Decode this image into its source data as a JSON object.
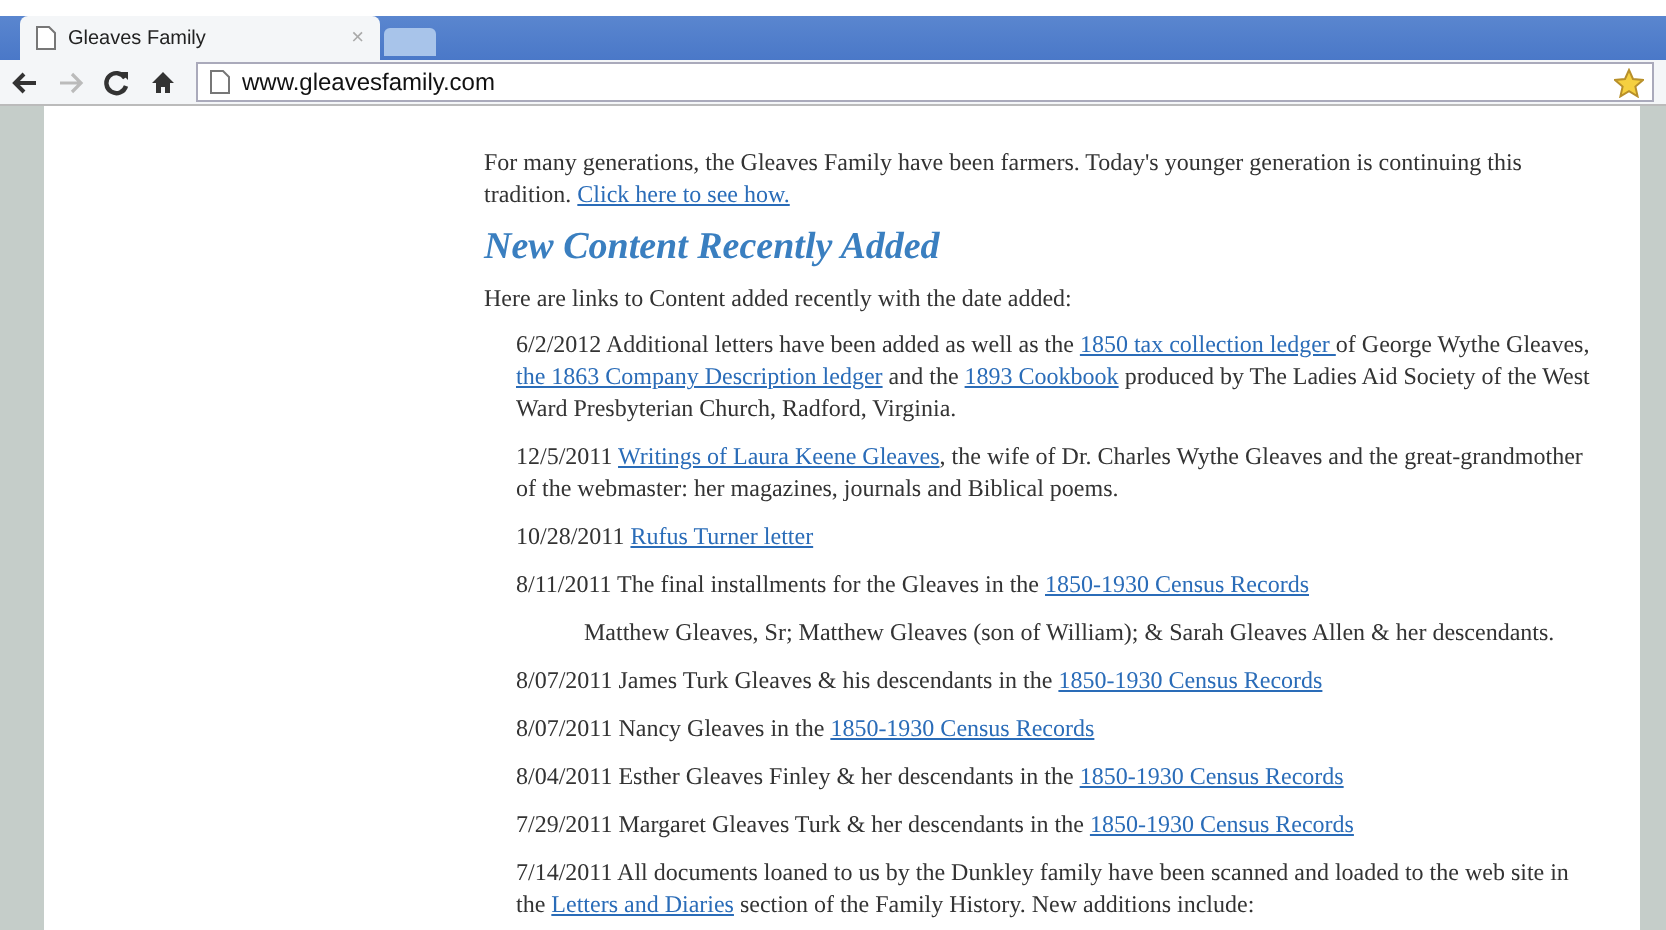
{
  "browser": {
    "tab_title": "Gleaves Family",
    "tab_close": "×",
    "address": "www.gleavesfamily.com"
  },
  "intro": [
    {
      "text": "For many generations, the Gleaves Family have been farmers.  Today's younger generation is continuing this tradition.  ",
      "link": false
    },
    {
      "text": "Click here to see how.",
      "link": true
    }
  ],
  "heading": "New Content Recently Added",
  "lead": "Here are links to Content added recently with the date added:",
  "entries": [
    {
      "kind": "entry",
      "parts": [
        {
          "text": "6/2/2012 Additional letters have been added as well as the ",
          "link": false
        },
        {
          "text": "1850 tax collection ledger ",
          "link": true
        },
        {
          "text": "of George Wythe Gleaves, ",
          "link": false
        },
        {
          "text": "the 1863 Company Description ledger",
          "link": true
        },
        {
          "text": " and the ",
          "link": false
        },
        {
          "text": "1893 Cookbook",
          "link": true
        },
        {
          "text": " produced by The Ladies Aid Society of the West Ward Presbyterian Church, Radford, Virginia.",
          "link": false
        }
      ]
    },
    {
      "kind": "entry",
      "parts": [
        {
          "text": "12/5/2011 ",
          "link": false
        },
        {
          "text": "Writings of Laura Keene Gleaves",
          "link": true
        },
        {
          "text": ", the wife of Dr. Charles Wythe Gleaves and the great-grandmother of the webmaster: her magazines, journals and Biblical poems.",
          "link": false
        }
      ]
    },
    {
      "kind": "entry",
      "parts": [
        {
          "text": "10/28/2011 ",
          "link": false
        },
        {
          "text": "Rufus Turner letter",
          "link": true
        }
      ]
    },
    {
      "kind": "entry",
      "parts": [
        {
          "text": "8/11/2011 The final installments for the Gleaves in the ",
          "link": false
        },
        {
          "text": "1850-1930 Census Records",
          "link": true
        }
      ]
    },
    {
      "kind": "sub",
      "parts": [
        {
          "text": "Matthew Gleaves, Sr; Matthew Gleaves (son of William); & Sarah Gleaves Allen & her descendants.",
          "link": false
        }
      ]
    },
    {
      "kind": "entry",
      "parts": [
        {
          "text": "8/07/2011 James Turk Gleaves & his descendants in the ",
          "link": false
        },
        {
          "text": "1850-1930 Census Records",
          "link": true
        }
      ]
    },
    {
      "kind": "entry",
      "parts": [
        {
          "text": "8/07/2011 Nancy Gleaves in the ",
          "link": false
        },
        {
          "text": "1850-1930 Census Records",
          "link": true
        }
      ]
    },
    {
      "kind": "entry",
      "parts": [
        {
          "text": "8/04/2011 Esther Gleaves Finley & her descendants in the ",
          "link": false
        },
        {
          "text": "1850-1930 Census Records",
          "link": true
        }
      ]
    },
    {
      "kind": "entry",
      "parts": [
        {
          "text": "7/29/2011 Margaret Gleaves Turk & her descendants in the ",
          "link": false
        },
        {
          "text": "1850-1930 Census Records",
          "link": true
        }
      ]
    },
    {
      "kind": "entry",
      "parts": [
        {
          "text": "7/14/2011 All documents loaned to us by the Dunkley family have been scanned and loaded to the web site in the ",
          "link": false
        },
        {
          "text": "Letters and Diaries",
          "link": true
        },
        {
          "text": " section of the Family History.  New additions include:",
          "link": false
        }
      ]
    }
  ]
}
